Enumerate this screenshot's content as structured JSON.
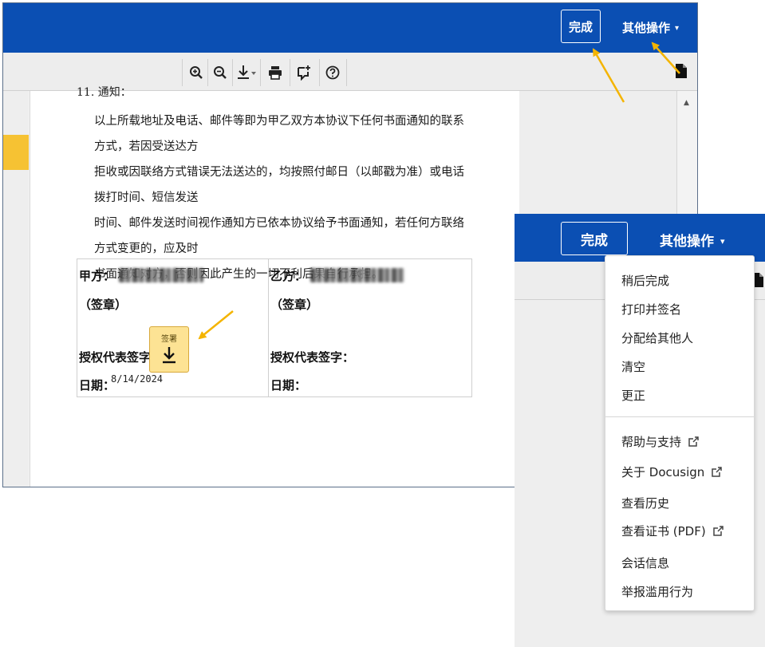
{
  "header": {
    "done_label": "完成",
    "more_actions_label": "其他操作",
    "caret": "▾"
  },
  "toolbar": {
    "tools": [
      {
        "name": "zoom-in-icon"
      },
      {
        "name": "zoom-out-icon"
      },
      {
        "name": "download-icon"
      },
      {
        "name": "print-icon"
      },
      {
        "name": "add-comment-icon"
      },
      {
        "name": "help-icon"
      }
    ]
  },
  "document": {
    "section_heading": "11. 通知：",
    "paragraph_lines": [
      "以上所载地址及电话、邮件等即为甲乙双方本协议下任何书面通知的联系方式，若因受送达方",
      "拒收或因联络方式错误无法送达的，均按照付邮日（以邮戳为准）或电话拨打时间、短信发送",
      "时间、邮件发送时间视作通知方已依本协议给予书面通知，若任何方联络方式变更的，应及时",
      "书面通知对方，否则因此产生的一切不利后果自行承担。"
    ],
    "party_a_label": "甲方：",
    "party_b_label": "乙方：",
    "seal_label": "（签章）",
    "authorized_signature_label": "授权代表签字：",
    "date_label": "日期：",
    "date_value": "8/14/2024",
    "sign_tag_label": "签署"
  },
  "menu": {
    "items_group1": [
      "稍后完成",
      "打印并签名",
      "分配给其他人",
      "清空",
      "更正"
    ],
    "items_group2": [
      "帮助与支持",
      "关于 Docusign",
      "查看历史",
      "查看证书 (PDF)",
      "会话信息",
      "举报滥用行为"
    ]
  },
  "colors": {
    "brand_blue": "#0b4fb3",
    "sign_tag": "#fde394",
    "annotation_arrow": "#f4b400",
    "left_marker": "#f6c233"
  }
}
